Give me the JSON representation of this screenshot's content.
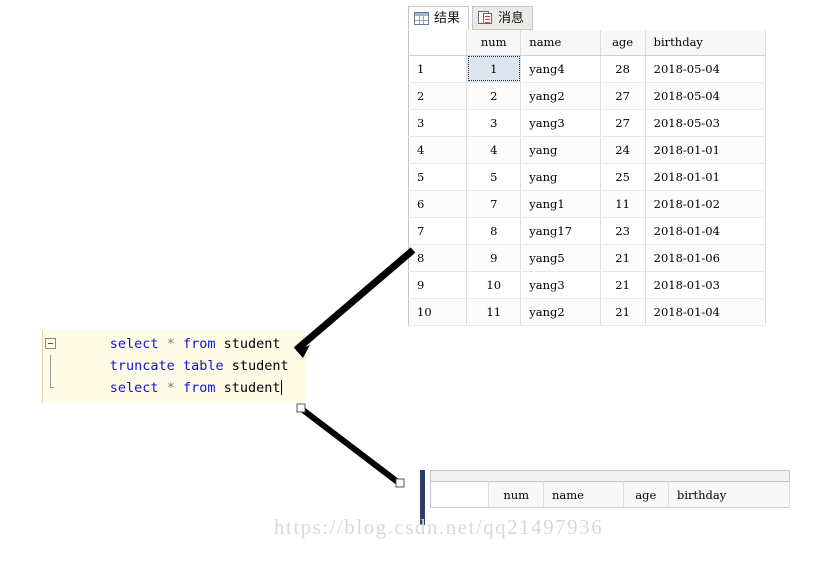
{
  "tabs": [
    {
      "label": "结果",
      "icon": "grid-icon",
      "active": true
    },
    {
      "label": "消息",
      "icon": "message-icon",
      "active": false
    }
  ],
  "results_grid": {
    "columns": [
      "",
      "num",
      "name",
      "age",
      "birthday"
    ],
    "selected_cell": {
      "row": 1,
      "column": "num",
      "value": "1"
    },
    "rows": [
      {
        "idx": "1",
        "num": "1",
        "name": "yang4",
        "age": "28",
        "birthday": "2018-05-04"
      },
      {
        "idx": "2",
        "num": "2",
        "name": "yang2",
        "age": "27",
        "birthday": "2018-05-04"
      },
      {
        "idx": "3",
        "num": "3",
        "name": "yang3",
        "age": "27",
        "birthday": "2018-05-03"
      },
      {
        "idx": "4",
        "num": "4",
        "name": "yang",
        "age": "24",
        "birthday": "2018-01-01"
      },
      {
        "idx": "5",
        "num": "5",
        "name": "yang",
        "age": "25",
        "birthday": "2018-01-01"
      },
      {
        "idx": "6",
        "num": "7",
        "name": "yang1",
        "age": "11",
        "birthday": "2018-01-02"
      },
      {
        "idx": "7",
        "num": "8",
        "name": "yang17",
        "age": "23",
        "birthday": "2018-01-04"
      },
      {
        "idx": "8",
        "num": "9",
        "name": "yang5",
        "age": "21",
        "birthday": "2018-01-06"
      },
      {
        "idx": "9",
        "num": "10",
        "name": "yang3",
        "age": "21",
        "birthday": "2018-01-03"
      },
      {
        "idx": "10",
        "num": "11",
        "name": "yang2",
        "age": "21",
        "birthday": "2018-01-04"
      }
    ]
  },
  "sql_editor": {
    "lines": [
      {
        "tokens": [
          {
            "t": "select",
            "k": "kw"
          },
          {
            "t": " ",
            "k": "id"
          },
          {
            "t": "*",
            "k": "op"
          },
          {
            "t": " ",
            "k": "id"
          },
          {
            "t": "from",
            "k": "kw"
          },
          {
            "t": " ",
            "k": "id"
          },
          {
            "t": "student",
            "k": "id"
          }
        ]
      },
      {
        "tokens": [
          {
            "t": "truncate",
            "k": "kw"
          },
          {
            "t": " ",
            "k": "id"
          },
          {
            "t": "table",
            "k": "kw"
          },
          {
            "t": " ",
            "k": "id"
          },
          {
            "t": "student",
            "k": "id"
          }
        ]
      },
      {
        "tokens": [
          {
            "t": "select",
            "k": "kw"
          },
          {
            "t": " ",
            "k": "id"
          },
          {
            "t": "*",
            "k": "op"
          },
          {
            "t": " ",
            "k": "id"
          },
          {
            "t": "from",
            "k": "kw"
          },
          {
            "t": " ",
            "k": "id"
          },
          {
            "t": "student",
            "k": "id"
          }
        ]
      }
    ],
    "full_text": "select * from student\ntruncate table student\nselect * from student"
  },
  "empty_grid": {
    "columns": [
      "",
      "num",
      "name",
      "age",
      "birthday"
    ],
    "rows": []
  },
  "colors": {
    "keyword": "#1414d0",
    "identifier": "#000000",
    "operator": "#808080",
    "editor_background": "#fefbe6",
    "selection": "#dce6f1",
    "annotation_line": "#000000",
    "marker": "#2a3f61"
  },
  "watermark": "https://blog.csdn.net/qq21497936"
}
